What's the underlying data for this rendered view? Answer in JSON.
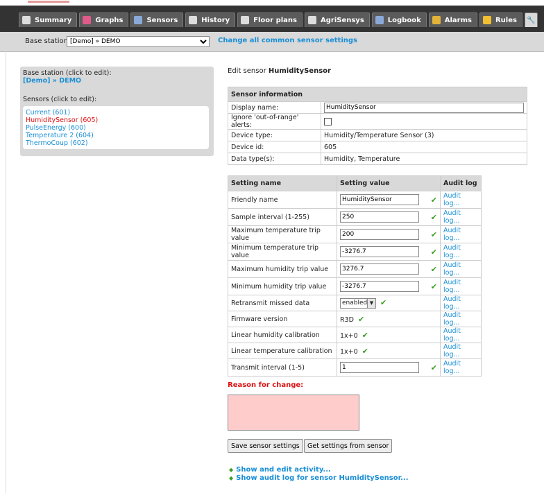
{
  "tabs": [
    {
      "label": "Summary",
      "icon": "wrench-icon",
      "color": "#ddd"
    },
    {
      "label": "Graphs",
      "icon": "graph-icon",
      "color": "#e05a8a"
    },
    {
      "label": "Sensors",
      "icon": "grid-icon",
      "color": "#8aa9d8"
    },
    {
      "label": "History",
      "icon": "cylinder-icon",
      "color": "#ddd"
    },
    {
      "label": "Floor plans",
      "icon": "cylinder-icon",
      "color": "#ddd"
    },
    {
      "label": "AgriSensys",
      "icon": "cylinder-icon",
      "color": "#ddd"
    },
    {
      "label": "Logbook",
      "icon": "grid-icon",
      "color": "#8aa9d8"
    },
    {
      "label": "Alarms",
      "icon": "bell-icon",
      "color": "#e2b23a"
    },
    {
      "label": "Rules",
      "icon": "lightning-icon",
      "color": "#f0c030"
    }
  ],
  "subbar": {
    "base_label": "Base station:",
    "base_value": "[Demo] » DEMO",
    "change_link": "Change all common sensor settings"
  },
  "sidebar": {
    "heading": "Base station (click to edit):",
    "base_station": "[Demo] » DEMO",
    "sensors_heading": "Sensors (click to edit):",
    "sensors": [
      {
        "label": "Current (601)",
        "selected": false
      },
      {
        "label": "HumiditySensor (605)",
        "selected": true
      },
      {
        "label": "PulseEnergy (600)",
        "selected": false
      },
      {
        "label": "Temperature 2 (604)",
        "selected": false
      },
      {
        "label": "ThermoCoup (602)",
        "selected": false
      }
    ]
  },
  "edit": {
    "prefix": "Edit sensor",
    "name": "HumiditySensor"
  },
  "info": {
    "header": "Sensor information",
    "display_name_label": "Display name:",
    "display_name_value": "HumiditySensor",
    "ignore_label": "Ignore 'out-of-range' alerts:",
    "device_type_label": "Device type:",
    "device_type_value": "Humidity/Temperature Sensor (3)",
    "device_id_label": "Device id:",
    "device_id_value": "605",
    "data_types_label": "Data type(s):",
    "data_types_value": "Humidity, Temperature"
  },
  "settings": {
    "col_name": "Setting name",
    "col_value": "Setting value",
    "col_audit": "Audit log",
    "audit_text": "Audit log...",
    "rows": [
      {
        "name": "Friendly name",
        "value": "HumiditySensor",
        "kind": "input"
      },
      {
        "name": "Sample interval (1-255)",
        "value": "250",
        "kind": "input"
      },
      {
        "name": "Maximum temperature trip value",
        "value": "200",
        "kind": "input"
      },
      {
        "name": "Minimum temperature trip value",
        "value": "-3276.7",
        "kind": "input"
      },
      {
        "name": "Maximum humidity trip value",
        "value": "3276.7",
        "kind": "input"
      },
      {
        "name": "Minimum humidity trip value",
        "value": "-3276.7",
        "kind": "input"
      },
      {
        "name": "Retransmit missed data",
        "value": "enabled",
        "kind": "select"
      },
      {
        "name": "Firmware version",
        "value": "R3D",
        "kind": "text"
      },
      {
        "name": "Linear humidity calibration",
        "value": "1x+0",
        "kind": "text"
      },
      {
        "name": "Linear temperature calibration",
        "value": "1x+0",
        "kind": "text"
      },
      {
        "name": "Transmit interval (1-5)",
        "value": "1",
        "kind": "input"
      }
    ]
  },
  "reason_label": "Reason for change:",
  "buttons": {
    "save": "Save sensor settings",
    "get": "Get settings from sensor"
  },
  "links": {
    "activity": "Show and edit activity...",
    "audit": "Show audit log for sensor HumiditySensor..."
  },
  "check_glyph": "✔"
}
